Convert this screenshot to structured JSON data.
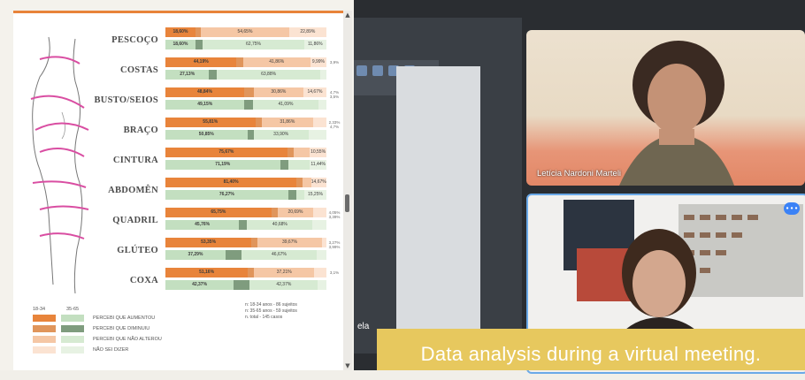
{
  "chart_data": {
    "type": "bar",
    "stacked": true,
    "orientation": "horizontal",
    "categories": [
      "PESCOÇO",
      "COSTAS",
      "BUSTO/SEIOS",
      "BRAÇO",
      "CINTURA",
      "ABDOMÊN",
      "QUADRIL",
      "GLÚTEO",
      "COXA"
    ],
    "groups": [
      "18-34",
      "35-65"
    ],
    "series": [
      {
        "name": "PERCEBI QUE AUMENTOU",
        "color_top": "#e8843b",
        "color_bottom": "#c3dfc0"
      },
      {
        "name": "PERCEBI QUE DIMINUIU",
        "color_top": "#e0955b",
        "color_bottom": "#7f9c7e"
      },
      {
        "name": "PERCEBI QUE NÃO ALTEROU",
        "color_top": "#f5c7a5",
        "color_bottom": "#d6ead2"
      },
      {
        "name": "NÃO SEI DIZER",
        "color_top": "#fbe3d2",
        "color_bottom": "#e7f2e3"
      }
    ],
    "rows": [
      {
        "cat": "PESCOÇO",
        "top": [
          {
            "v": 18.6,
            "t": "18,60%"
          },
          {
            "v": 3.5,
            "t": ""
          },
          {
            "v": 54.65,
            "t": "54,65%"
          },
          {
            "v": 23.25,
            "t": "22,89%"
          }
        ],
        "bot": [
          {
            "v": 18.6,
            "t": "18,60%"
          },
          {
            "v": 4.7,
            "t": ""
          },
          {
            "v": 62.75,
            "t": "62,75%"
          },
          {
            "v": 13.95,
            "t": "11,86%"
          }
        ],
        "side": []
      },
      {
        "cat": "COSTAS",
        "top": [
          {
            "v": 44.19,
            "t": "44,19%"
          },
          {
            "v": 4.0,
            "t": ""
          },
          {
            "v": 41.86,
            "t": "41,86%"
          },
          {
            "v": 9.95,
            "t": "9,99%"
          }
        ],
        "bot": [
          {
            "v": 27.13,
            "t": "27,13%"
          },
          {
            "v": 5.0,
            "t": ""
          },
          {
            "v": 63.88,
            "t": "63,88%"
          },
          {
            "v": 3.99,
            "t": ""
          }
        ],
        "side": [
          "3,9%"
        ]
      },
      {
        "cat": "BUSTO/SEIOS",
        "top": [
          {
            "v": 48.84,
            "t": "48,84%"
          },
          {
            "v": 6.0,
            "t": ""
          },
          {
            "v": 30.86,
            "t": "30,86%"
          },
          {
            "v": 14.3,
            "t": "14,67%"
          }
        ],
        "bot": [
          {
            "v": 49.15,
            "t": "49,15%"
          },
          {
            "v": 5.0,
            "t": ""
          },
          {
            "v": 41.09,
            "t": "41,09%"
          },
          {
            "v": 4.76,
            "t": ""
          }
        ],
        "side": [
          "4,7%",
          "3,5%"
        ]
      },
      {
        "cat": "BRAÇO",
        "top": [
          {
            "v": 55.81,
            "t": "55,81%"
          },
          {
            "v": 4.0,
            "t": ""
          },
          {
            "v": 31.86,
            "t": "31,86%"
          },
          {
            "v": 8.33,
            "t": ""
          }
        ],
        "bot": [
          {
            "v": 50.85,
            "t": "50,85%"
          },
          {
            "v": 4.0,
            "t": ""
          },
          {
            "v": 33.9,
            "t": "33,90%"
          },
          {
            "v": 11.25,
            "t": ""
          }
        ],
        "side": [
          "2,33%",
          "4,7%"
        ]
      },
      {
        "cat": "CINTURA",
        "top": [
          {
            "v": 75.67,
            "t": "75,67%"
          },
          {
            "v": 4.0,
            "t": ""
          },
          {
            "v": 10.0,
            "t": ""
          },
          {
            "v": 10.33,
            "t": "10,55%"
          }
        ],
        "bot": [
          {
            "v": 71.19,
            "t": "71,19%"
          },
          {
            "v": 5.0,
            "t": ""
          },
          {
            "v": 13.6,
            "t": ""
          },
          {
            "v": 10.21,
            "t": "11,44%"
          }
        ],
        "side": []
      },
      {
        "cat": "ABDOMÊN",
        "top": [
          {
            "v": 81.4,
            "t": "81,40%"
          },
          {
            "v": 4.0,
            "t": ""
          },
          {
            "v": 5.0,
            "t": ""
          },
          {
            "v": 9.6,
            "t": "14,67%"
          }
        ],
        "bot": [
          {
            "v": 76.27,
            "t": "76,27%"
          },
          {
            "v": 5.0,
            "t": ""
          },
          {
            "v": 5.0,
            "t": ""
          },
          {
            "v": 13.73,
            "t": "15,25%"
          }
        ],
        "side": []
      },
      {
        "cat": "QUADRIL",
        "top": [
          {
            "v": 65.75,
            "t": "65,75%"
          },
          {
            "v": 4.0,
            "t": ""
          },
          {
            "v": 22.0,
            "t": "20,69%"
          },
          {
            "v": 8.25,
            "t": ""
          }
        ],
        "bot": [
          {
            "v": 45.76,
            "t": "45,76%"
          },
          {
            "v": 5.0,
            "t": ""
          },
          {
            "v": 40.68,
            "t": "40,68%"
          },
          {
            "v": 8.56,
            "t": ""
          }
        ],
        "side": [
          "4,05%",
          "3,39%"
        ]
      },
      {
        "cat": "GLÚTEO",
        "top": [
          {
            "v": 53.35,
            "t": "53,35%"
          },
          {
            "v": 4.0,
            "t": ""
          },
          {
            "v": 39.67,
            "t": "39,67%"
          },
          {
            "v": 2.98,
            "t": ""
          }
        ],
        "bot": [
          {
            "v": 37.29,
            "t": "37,29%"
          },
          {
            "v": 10.0,
            "t": ""
          },
          {
            "v": 46.67,
            "t": "46,67%"
          },
          {
            "v": 6.04,
            "t": ""
          }
        ],
        "side": [
          "3,27%",
          "3,99%"
        ]
      },
      {
        "cat": "COXA",
        "top": [
          {
            "v": 51.16,
            "t": "51,16%"
          },
          {
            "v": 4.0,
            "t": ""
          },
          {
            "v": 37.21,
            "t": "37,21%"
          },
          {
            "v": 7.63,
            "t": ""
          }
        ],
        "bot": [
          {
            "v": 42.37,
            "t": "42,37%"
          },
          {
            "v": 10.0,
            "t": ""
          },
          {
            "v": 42.37,
            "t": "42,37%"
          },
          {
            "v": 5.26,
            "t": ""
          }
        ],
        "side": [
          "3,1%"
        ]
      }
    ],
    "legend_groups": {
      "left": "18-34",
      "right": "35-65"
    },
    "notes": [
      "n: 18-34 anos - 86 sujeitos",
      "n: 35-65 anos - 59 sujeitos",
      "n. total - 145 casos"
    ]
  },
  "meeting": {
    "participant1": "Letícia Nardoni Marteli",
    "share_label": "ela",
    "caption": "Data analysis during a virtual meeting."
  },
  "colors": {
    "accent": "#e8833a",
    "caption_bg": "#e7c85e",
    "tile_border": "#6aa9e8",
    "mic": "#3b82f6"
  }
}
